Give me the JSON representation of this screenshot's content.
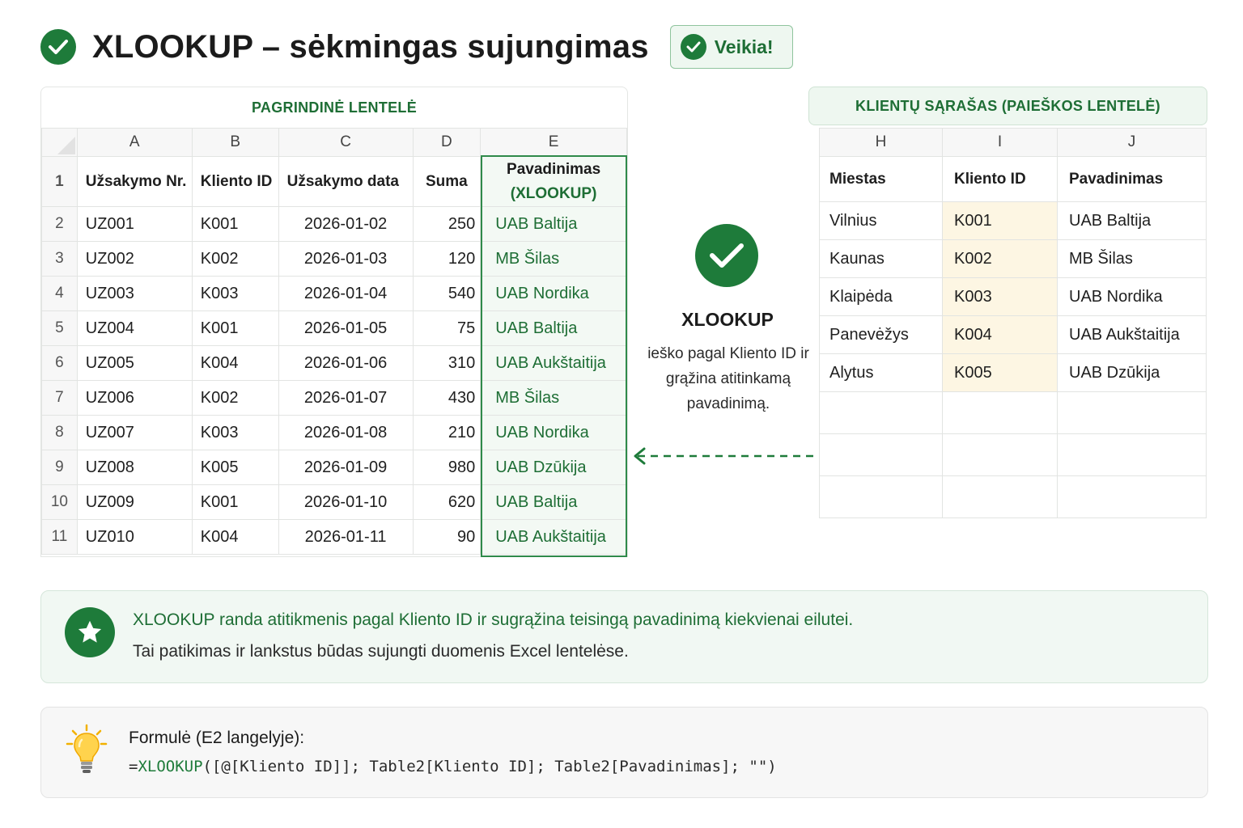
{
  "header": {
    "title": "XLOOKUP – sėkmingas sujungimas",
    "badge": "Veikia!"
  },
  "main_table": {
    "title": "PAGRINDINĖ LENTELĖ",
    "columns": [
      "A",
      "B",
      "C",
      "D",
      "E"
    ],
    "headers": [
      "Užsakymo Nr.",
      "Kliento ID",
      "Užsakymo data",
      "Suma"
    ],
    "e_header_line1": "Pavadinimas",
    "e_header_line2": "(XLOOKUP)",
    "header_row_number": "1",
    "rows": [
      {
        "n": "2",
        "order": "UZ001",
        "client": "K001",
        "date": "2026-01-02",
        "sum": "250",
        "name": "UAB Baltija"
      },
      {
        "n": "3",
        "order": "UZ002",
        "client": "K002",
        "date": "2026-01-03",
        "sum": "120",
        "name": "MB Šilas"
      },
      {
        "n": "4",
        "order": "UZ003",
        "client": "K003",
        "date": "2026-01-04",
        "sum": "540",
        "name": "UAB Nordika"
      },
      {
        "n": "5",
        "order": "UZ004",
        "client": "K001",
        "date": "2026-01-05",
        "sum": "75",
        "name": "UAB Baltija"
      },
      {
        "n": "6",
        "order": "UZ005",
        "client": "K004",
        "date": "2026-01-06",
        "sum": "310",
        "name": "UAB Aukštaitija"
      },
      {
        "n": "7",
        "order": "UZ006",
        "client": "K002",
        "date": "2026-01-07",
        "sum": "430",
        "name": "MB Šilas"
      },
      {
        "n": "8",
        "order": "UZ007",
        "client": "K003",
        "date": "2026-01-08",
        "sum": "210",
        "name": "UAB Nordika"
      },
      {
        "n": "9",
        "order": "UZ008",
        "client": "K005",
        "date": "2026-01-09",
        "sum": "980",
        "name": "UAB Dzūkija"
      },
      {
        "n": "10",
        "order": "UZ009",
        "client": "K001",
        "date": "2026-01-10",
        "sum": "620",
        "name": "UAB Baltija"
      },
      {
        "n": "11",
        "order": "UZ010",
        "client": "K004",
        "date": "2026-01-11",
        "sum": "90",
        "name": "UAB Aukštaitija"
      }
    ]
  },
  "center": {
    "title": "XLOOKUP",
    "description": "ieško pagal Kliento ID ir grąžina atitinkamą pavadinimą."
  },
  "lookup_table": {
    "title": "KLIENTŲ SĄRAŠAS (PAIEŠKOS LENTELĖ)",
    "columns": [
      "H",
      "I",
      "J"
    ],
    "headers": [
      "Miestas",
      "Kliento ID",
      "Pavadinimas"
    ],
    "rows": [
      {
        "city": "Vilnius",
        "id": "K001",
        "name": "UAB Baltija"
      },
      {
        "city": "Kaunas",
        "id": "K002",
        "name": "MB Šilas"
      },
      {
        "city": "Klaipėda",
        "id": "K003",
        "name": "UAB Nordika"
      },
      {
        "city": "Panevėžys",
        "id": "K004",
        "name": "UAB Aukštaitija"
      },
      {
        "city": "Alytus",
        "id": "K005",
        "name": "UAB Dzūkija"
      }
    ]
  },
  "info": {
    "line1": "XLOOKUP randa atitikmenis pagal Kliento ID ir sugrąžina teisingą pavadinimą kiekvienai eilutei.",
    "line2": "Tai patikimas ir lankstus būdas sujungti duomenis Excel lentelėse."
  },
  "formula": {
    "label": "Formulė (E2 langelyje):",
    "prefix": "=",
    "function": "XLOOKUP",
    "args": "([@[Kliento ID]]; Table2[Kliento ID]; Table2[Pavadinimas]; \"\")"
  },
  "icons": {
    "header": "check-circle-icon",
    "badge": "check-circle-icon",
    "center": "check-circle-icon",
    "arrow": "dashed-arrow-left-icon",
    "info": "star-icon",
    "formula": "lightbulb-icon"
  },
  "colors": {
    "accent": "#1e7b3a",
    "accent_text": "#1e6e35",
    "id_highlight": "#fdf6e3",
    "panel_tint": "#eef7f0"
  }
}
